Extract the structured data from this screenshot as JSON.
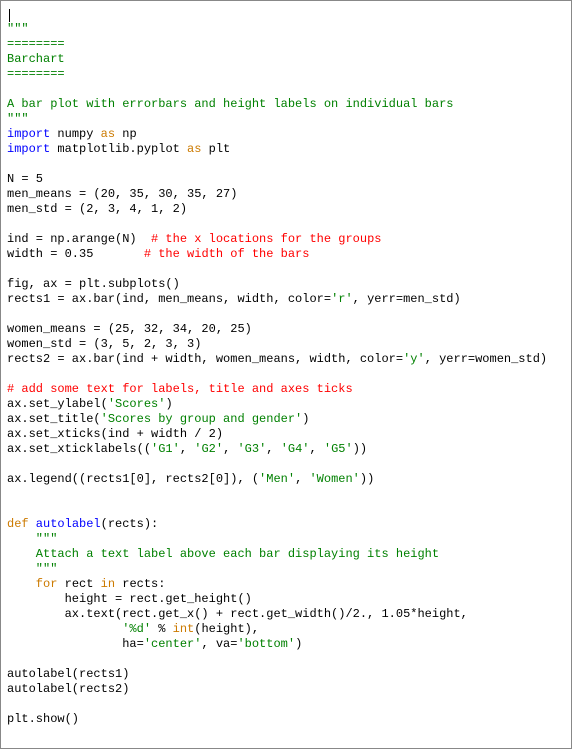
{
  "code": {
    "l1": "\"\"\"",
    "l2": "========",
    "l3": "Barchart",
    "l4": "========",
    "l5": "",
    "l6": "A bar plot with errorbars and height labels on individual bars",
    "l7": "\"\"\"",
    "l8_import": "import",
    "l8_mod1": " numpy ",
    "l8_as": "as",
    "l8_mod2": " np",
    "l9_import": "import",
    "l9_mod1": " matplotlib.pyplot ",
    "l9_as": "as",
    "l9_mod2": " plt",
    "l11": "N = 5",
    "l12": "men_means = (20, 35, 30, 35, 27)",
    "l13": "men_std = (2, 3, 4, 1, 2)",
    "l15a": "ind = np.arange(N)  ",
    "l15b": "# the x locations for the groups",
    "l16a": "width = 0.35       ",
    "l16b": "# the width of the bars",
    "l18": "fig, ax = plt.subplots()",
    "l19a": "rects1 = ax.bar(ind, men_means, width, color=",
    "l19b": "'r'",
    "l19c": ", yerr=men_std)",
    "l21": "women_means = (25, 32, 34, 20, 25)",
    "l22": "women_std = (3, 5, 2, 3, 3)",
    "l23a": "rects2 = ax.bar(ind + width, women_means, width, color=",
    "l23b": "'y'",
    "l23c": ", yerr=women_std)",
    "l25": "# add some text for labels, title and axes ticks",
    "l26a": "ax.set_ylabel(",
    "l26b": "'Scores'",
    "l26c": ")",
    "l27a": "ax.set_title(",
    "l27b": "'Scores by group and gender'",
    "l27c": ")",
    "l28": "ax.set_xticks(ind + width / 2)",
    "l29a": "ax.set_xticklabels((",
    "l29b": "'G1'",
    "l29c": ", ",
    "l29d": "'G2'",
    "l29e": ", ",
    "l29f": "'G3'",
    "l29g": ", ",
    "l29h": "'G4'",
    "l29i": ", ",
    "l29j": "'G5'",
    "l29k": "))",
    "l31a": "ax.legend((rects1[0], rects2[0]), (",
    "l31b": "'Men'",
    "l31c": ", ",
    "l31d": "'Women'",
    "l31e": "))",
    "l34_def": "def",
    "l34_fn": " autolabel",
    "l34_sig": "(rects):",
    "l35": "    \"\"\"",
    "l36": "    Attach a text label above each bar displaying its height",
    "l37": "    \"\"\"",
    "l38_for": "    for",
    "l38_a": " rect ",
    "l38_in": "in",
    "l38_b": " rects:",
    "l39": "        height = rect.get_height()",
    "l40": "        ax.text(rect.get_x() + rect.get_width()/2., 1.05*height,",
    "l41a": "                ",
    "l41b": "'%d'",
    "l41c": " % ",
    "l41d": "int",
    "l41e": "(height),",
    "l42a": "                ha=",
    "l42b": "'center'",
    "l42c": ", va=",
    "l42d": "'bottom'",
    "l42e": ")",
    "l44": "autolabel(rects1)",
    "l45": "autolabel(rects2)",
    "l47": "plt.show()"
  }
}
